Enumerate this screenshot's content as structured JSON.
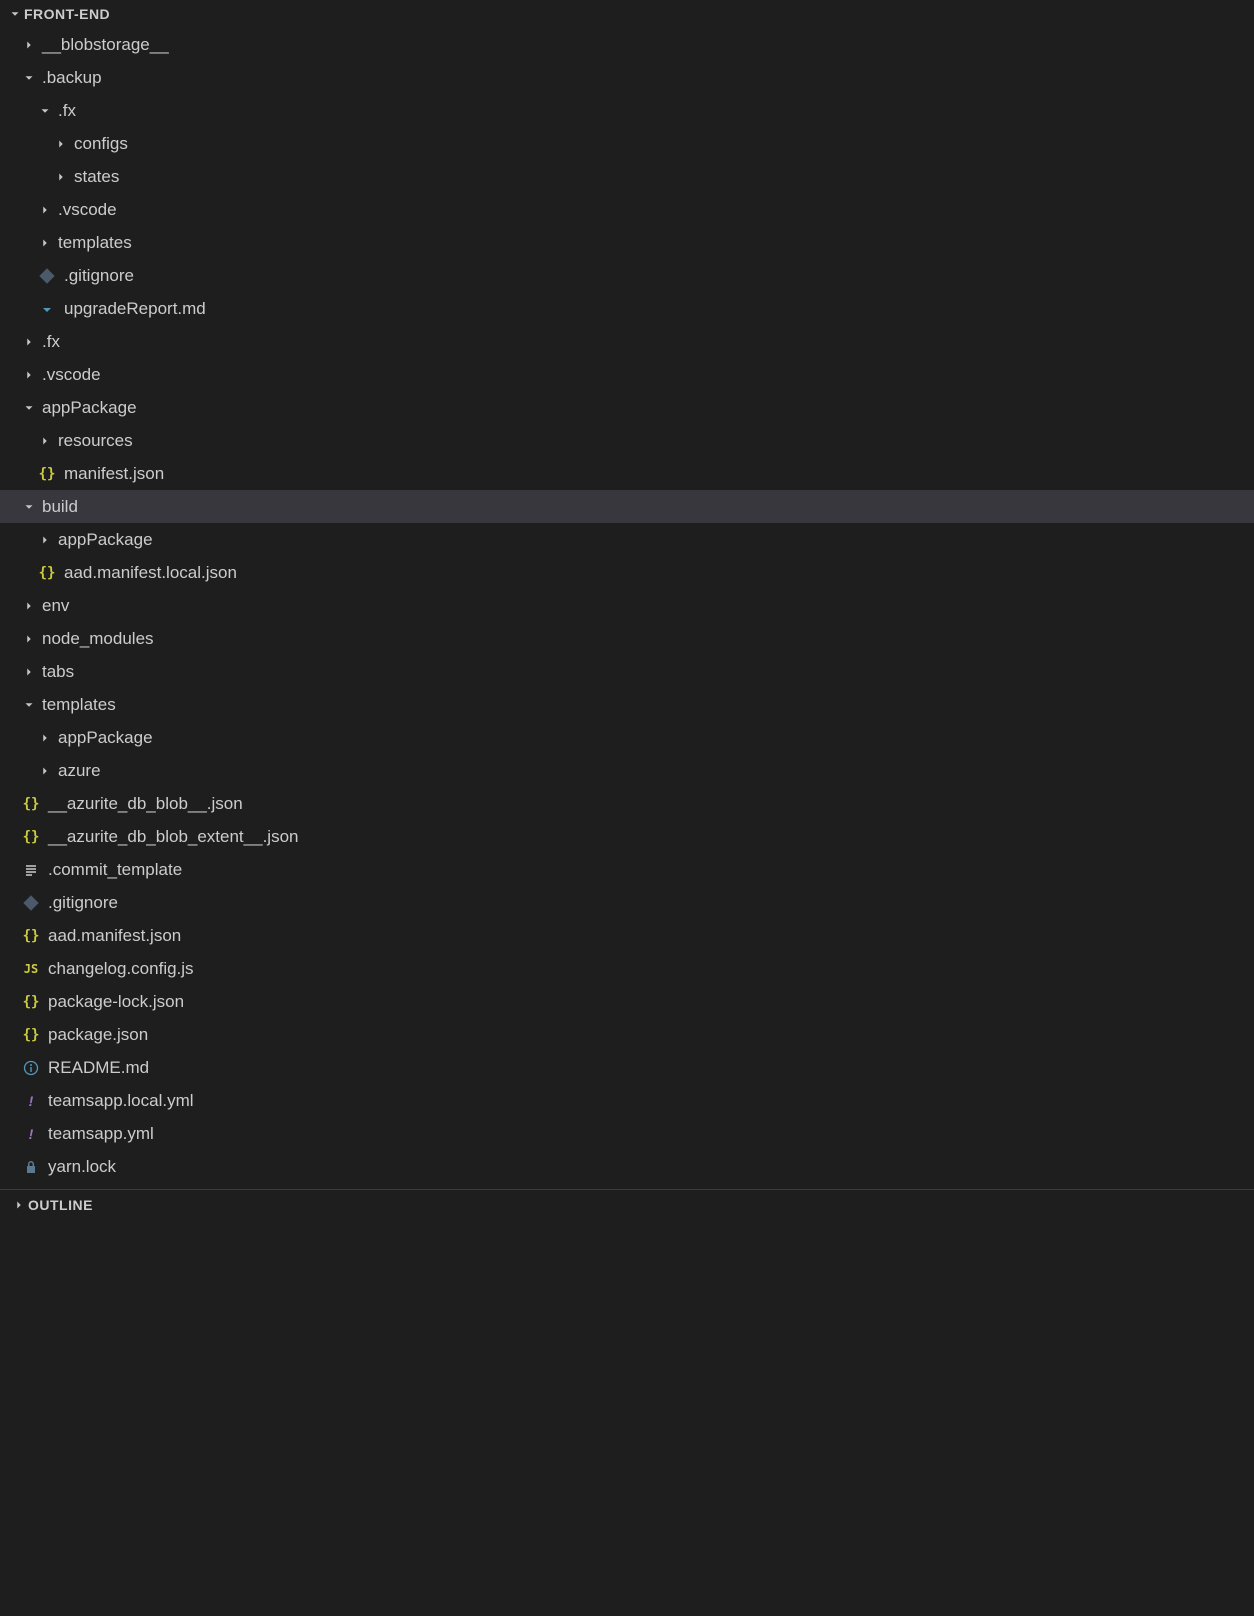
{
  "explorer": {
    "root_label": "FRONT-END",
    "outline_label": "OUTLINE",
    "items": [
      {
        "depth": 1,
        "kind": "folder",
        "state": "closed",
        "label": "__blobstorage__"
      },
      {
        "depth": 1,
        "kind": "folder",
        "state": "open",
        "label": ".backup"
      },
      {
        "depth": 2,
        "kind": "folder",
        "state": "open",
        "label": ".fx"
      },
      {
        "depth": 3,
        "kind": "folder",
        "state": "closed",
        "label": "configs"
      },
      {
        "depth": 3,
        "kind": "folder",
        "state": "closed",
        "label": "states"
      },
      {
        "depth": 2,
        "kind": "folder",
        "state": "closed",
        "label": ".vscode"
      },
      {
        "depth": 2,
        "kind": "folder",
        "state": "closed",
        "label": "templates"
      },
      {
        "depth": 2,
        "kind": "file",
        "icon": "gitignore",
        "label": ".gitignore"
      },
      {
        "depth": 2,
        "kind": "file",
        "icon": "md-arrow",
        "label": "upgradeReport.md"
      },
      {
        "depth": 1,
        "kind": "folder",
        "state": "closed",
        "label": ".fx"
      },
      {
        "depth": 1,
        "kind": "folder",
        "state": "closed",
        "label": ".vscode"
      },
      {
        "depth": 1,
        "kind": "folder",
        "state": "open",
        "label": "appPackage"
      },
      {
        "depth": 2,
        "kind": "folder",
        "state": "closed",
        "label": "resources"
      },
      {
        "depth": 2,
        "kind": "file",
        "icon": "json",
        "label": "manifest.json"
      },
      {
        "depth": 1,
        "kind": "folder",
        "state": "open",
        "label": "build",
        "selected": true
      },
      {
        "depth": 2,
        "kind": "folder",
        "state": "closed",
        "label": "appPackage"
      },
      {
        "depth": 2,
        "kind": "file",
        "icon": "json",
        "label": "aad.manifest.local.json"
      },
      {
        "depth": 1,
        "kind": "folder",
        "state": "closed",
        "label": "env"
      },
      {
        "depth": 1,
        "kind": "folder",
        "state": "closed",
        "label": "node_modules"
      },
      {
        "depth": 1,
        "kind": "folder",
        "state": "closed",
        "label": "tabs"
      },
      {
        "depth": 1,
        "kind": "folder",
        "state": "open",
        "label": "templates"
      },
      {
        "depth": 2,
        "kind": "folder",
        "state": "closed",
        "label": "appPackage"
      },
      {
        "depth": 2,
        "kind": "folder",
        "state": "closed",
        "label": "azure"
      },
      {
        "depth": 1,
        "kind": "file",
        "icon": "json",
        "label": "__azurite_db_blob__.json"
      },
      {
        "depth": 1,
        "kind": "file",
        "icon": "json",
        "label": "__azurite_db_blob_extent__.json"
      },
      {
        "depth": 1,
        "kind": "file",
        "icon": "lines",
        "label": ".commit_template"
      },
      {
        "depth": 1,
        "kind": "file",
        "icon": "gitignore",
        "label": ".gitignore"
      },
      {
        "depth": 1,
        "kind": "file",
        "icon": "json",
        "label": "aad.manifest.json"
      },
      {
        "depth": 1,
        "kind": "file",
        "icon": "js",
        "label": "changelog.config.js"
      },
      {
        "depth": 1,
        "kind": "file",
        "icon": "json",
        "label": "package-lock.json"
      },
      {
        "depth": 1,
        "kind": "file",
        "icon": "json",
        "label": "package.json"
      },
      {
        "depth": 1,
        "kind": "file",
        "icon": "info",
        "label": "README.md"
      },
      {
        "depth": 1,
        "kind": "file",
        "icon": "yaml",
        "label": "teamsapp.local.yml"
      },
      {
        "depth": 1,
        "kind": "file",
        "icon": "yaml",
        "label": "teamsapp.yml"
      },
      {
        "depth": 1,
        "kind": "file",
        "icon": "lock",
        "label": "yarn.lock"
      }
    ]
  }
}
